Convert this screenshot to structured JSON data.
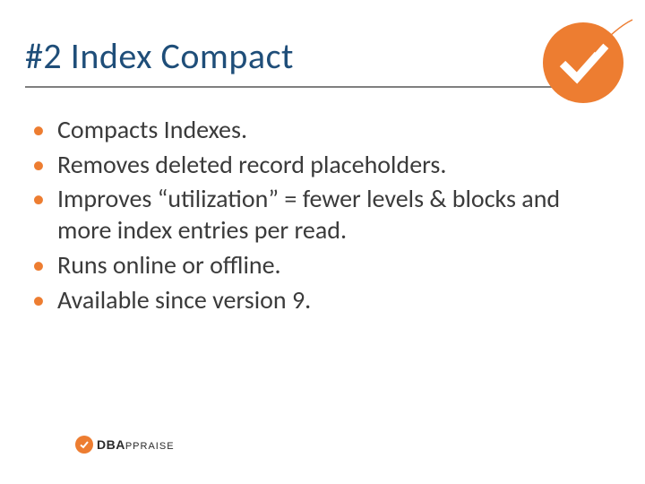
{
  "title": "#2 Index Compact",
  "bullets": [
    "Compacts Indexes.",
    "Removes deleted record placeholders.",
    "Improves “utilization” = fewer levels & blocks and more index entries per read.",
    "Runs online or offline.",
    "Available since version 9."
  ],
  "brand": {
    "name_bold": "DBA",
    "name_light": "PPRAISE"
  }
}
